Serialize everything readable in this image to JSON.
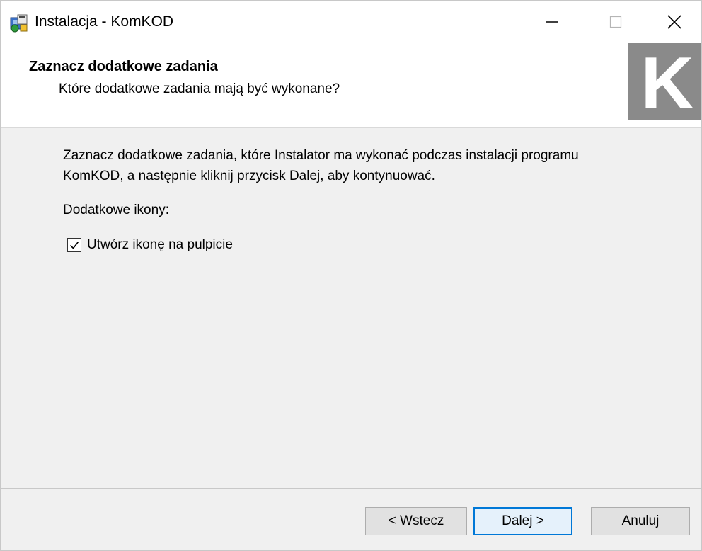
{
  "window": {
    "title": "Instalacja - KomKOD"
  },
  "header": {
    "title": "Zaznacz dodatkowe zadania",
    "subtitle": "Które dodatkowe zadania mają być wykonane?",
    "logo_letter": "K"
  },
  "content": {
    "description_line1": "Zaznacz dodatkowe zadania, które Instalator ma wykonać podczas instalacji programu",
    "description_line2": "KomKOD, a następnie kliknij przycisk Dalej, aby kontynuować.",
    "section_label": "Dodatkowe ikony:",
    "tasks": [
      {
        "label": "Utwórz ikonę na pulpicie",
        "checked": true
      }
    ]
  },
  "buttons": {
    "back": "< Wstecz",
    "next": "Dalej >",
    "cancel": "Anuluj"
  },
  "icons": {
    "app": "installer-icon",
    "minimize": "minimize-icon",
    "maximize": "maximize-icon",
    "close": "close-icon",
    "check": "checkmark-icon"
  },
  "colors": {
    "accent": "#0078d7",
    "logo_bg": "#8a8a8a",
    "window_bg": "#f0f0f0",
    "header_bg": "#ffffff"
  }
}
